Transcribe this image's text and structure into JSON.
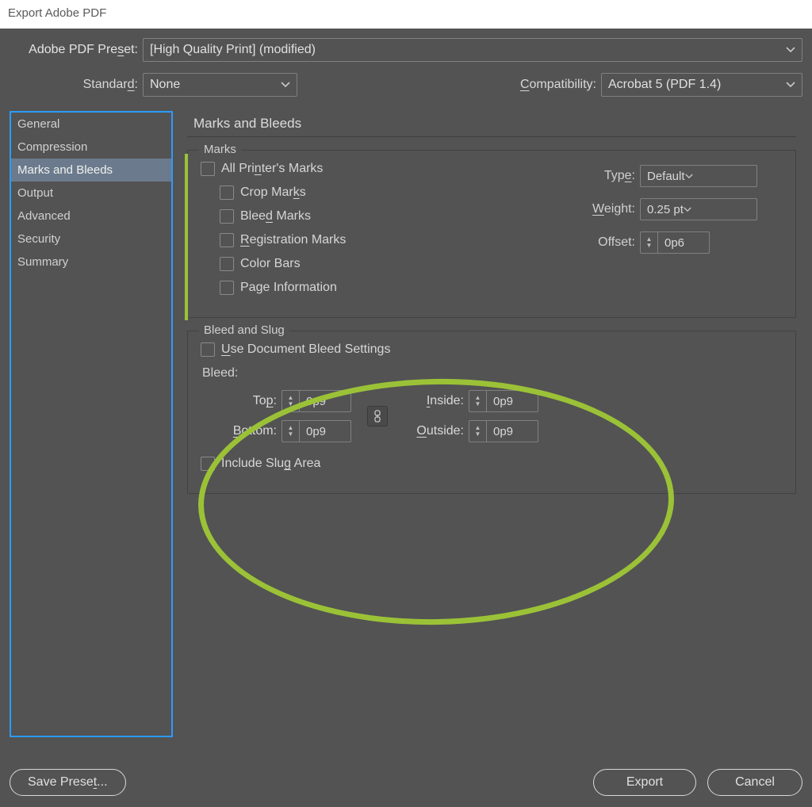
{
  "window": {
    "title": "Export Adobe PDF"
  },
  "top": {
    "preset_label": "Adobe PDF Preset:",
    "preset_value": "[High Quality Print] (modified)",
    "standard_label": "Standard:",
    "standard_value": "None",
    "compat_label": "Compatibility:",
    "compat_value": "Acrobat 5 (PDF 1.4)"
  },
  "sidebar": {
    "items": [
      {
        "label": "General"
      },
      {
        "label": "Compression"
      },
      {
        "label": "Marks and Bleeds"
      },
      {
        "label": "Output"
      },
      {
        "label": "Advanced"
      },
      {
        "label": "Security"
      },
      {
        "label": "Summary"
      }
    ],
    "selected_index": 2
  },
  "panel": {
    "title": "Marks and Bleeds",
    "marks": {
      "legend": "Marks",
      "all_label_pre": "All Pri",
      "all_label_ul": "n",
      "all_label_post": "ter's Marks",
      "crop_pre": "Crop Mar",
      "crop_ul": "k",
      "crop_post": "s",
      "bleed_pre": "Blee",
      "bleed_ul": "d",
      "bleed_post": " Marks",
      "reg_ul": "R",
      "reg_post": "egistration Marks",
      "color_label": "Color Bars",
      "page_label": "Page Information",
      "type_pre": "Typ",
      "type_ul": "e",
      "type_post": ":",
      "type_value": "Default",
      "weight_ul": "W",
      "weight_post": "eight:",
      "weight_value": "0.25 pt",
      "offset_label": "Offset:",
      "offset_value": "0p6"
    },
    "bleed": {
      "legend": "Bleed and Slug",
      "usedoc_ul": "U",
      "usedoc_post": "se Document Bleed Settings",
      "section": "Bleed:",
      "top_pre": "To",
      "top_ul": "p",
      "top_post": ":",
      "top_value": "0p9",
      "bottom_ul": "B",
      "bottom_post": "ottom:",
      "bottom_value": "0p9",
      "inside_ul": "I",
      "inside_post": "nside:",
      "inside_value": "0p9",
      "outside_ul": "O",
      "outside_post": "utside:",
      "outside_value": "0p9",
      "slug_pre": "Include Slu",
      "slug_ul": "g",
      "slug_post": " Area"
    }
  },
  "buttons": {
    "save_preset_pre": "Save Prese",
    "save_preset_ul": "t",
    "save_preset_post": "...",
    "export": "Export",
    "cancel": "Cancel"
  }
}
